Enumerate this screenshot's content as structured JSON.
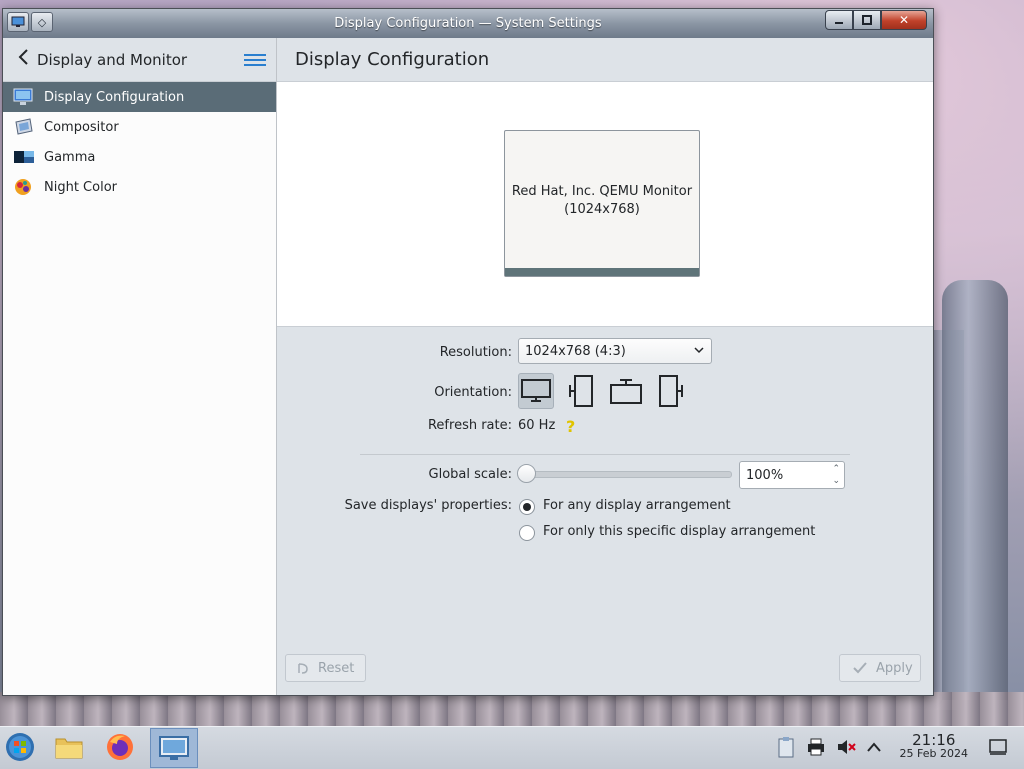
{
  "window": {
    "title": "Display Configuration — System Settings"
  },
  "sidebar": {
    "header": "Display and Monitor",
    "items": [
      {
        "label": "Display Configuration",
        "icon": "display-config-icon",
        "active": true
      },
      {
        "label": "Compositor",
        "icon": "compositor-icon",
        "active": false
      },
      {
        "label": "Gamma",
        "icon": "gamma-icon",
        "active": false
      },
      {
        "label": "Night Color",
        "icon": "night-color-icon",
        "active": false
      }
    ]
  },
  "main": {
    "title": "Display Configuration",
    "monitor": {
      "name": "Red Hat, Inc. QEMU Monitor",
      "resolution": "(1024x768)"
    },
    "resolution": {
      "label": "Resolution:",
      "value": "1024x768 (4:3)"
    },
    "orientation": {
      "label": "Orientation:"
    },
    "refresh": {
      "label": "Refresh rate:",
      "value": "60 Hz"
    },
    "global_scale": {
      "label": "Global scale:",
      "value": "100%",
      "slider_fraction": 0.0
    },
    "save_properties": {
      "label": "Save displays' properties:",
      "options": [
        "For any display arrangement",
        "For only this specific display arrangement"
      ],
      "selected_index": 0
    },
    "buttons": {
      "reset": "Reset",
      "apply": "Apply"
    }
  },
  "taskbar": {
    "time": "21:16",
    "date": "25 Feb 2024"
  },
  "colors": {
    "active_item": "#5a6c77",
    "accent": "#2a7fcf",
    "hint": "#e0c400"
  }
}
